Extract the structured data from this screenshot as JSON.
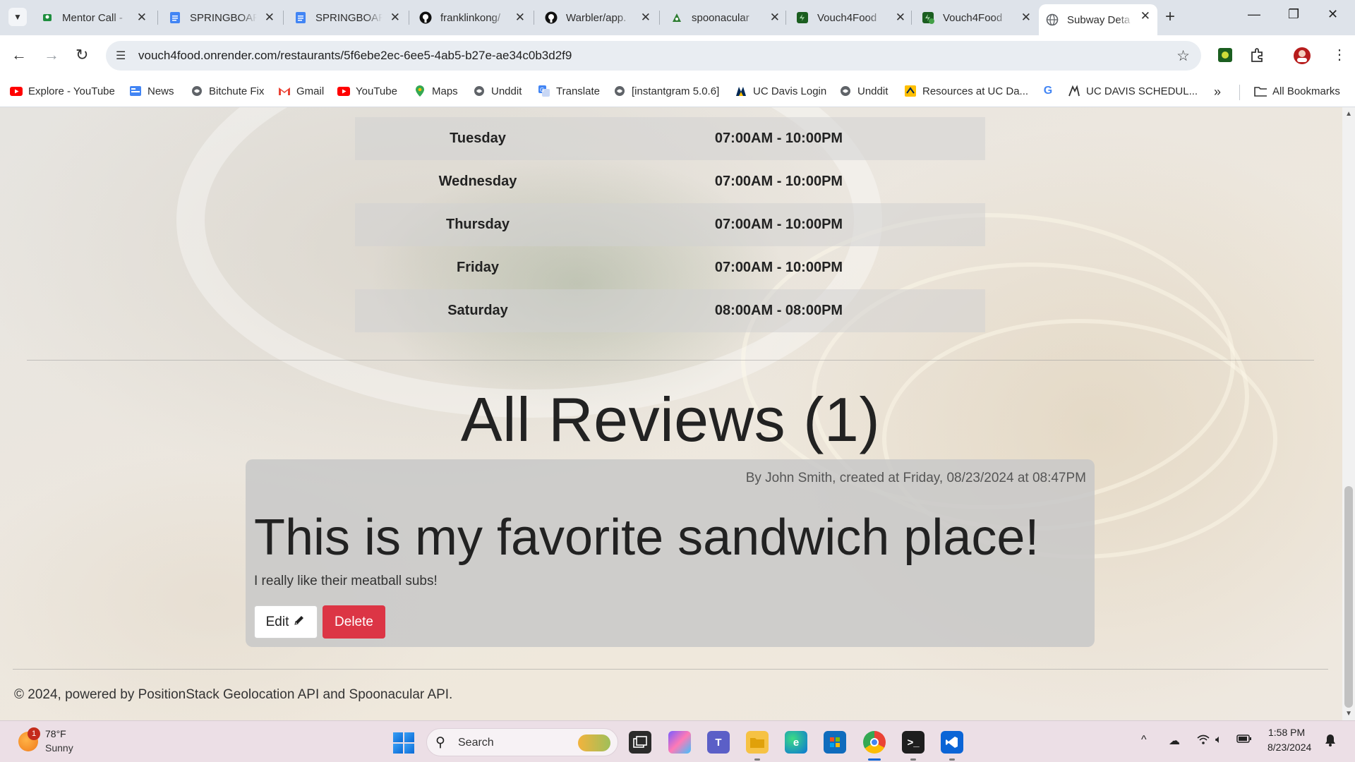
{
  "browser": {
    "tabs": [
      {
        "label": "Mentor Call - ",
        "icon": "meet-icon",
        "color": "#1e8e3e"
      },
      {
        "label": "SPRINGBOARD",
        "icon": "docs-icon",
        "color": "#4285f4"
      },
      {
        "label": "SPRINGBOARD",
        "icon": "docs-icon",
        "color": "#4285f4"
      },
      {
        "label": "franklinkong/",
        "icon": "github-icon",
        "color": "#111111"
      },
      {
        "label": "Warbler/app.",
        "icon": "github-icon",
        "color": "#111111"
      },
      {
        "label": "spoonacular",
        "icon": "spoonacular-icon",
        "color": "#2e7d32"
      },
      {
        "label": "Vouch4Food",
        "icon": "vouch4food-icon",
        "color": "#1b5e20"
      },
      {
        "label": "Vouch4Food",
        "icon": "vouch4food-icon",
        "color": "#1b5e20"
      },
      {
        "label": "Subway Deta",
        "icon": "globe-icon",
        "color": "#5f6368",
        "active": true
      }
    ],
    "url": "vouch4food.onrender.com/restaurants/5f6ebe2ec-6ee5-4ab5-b27e-ae34c0b3d2f9",
    "bookmarks": [
      {
        "label": "Explore - YouTube",
        "icon": "youtube-icon"
      },
      {
        "label": "News",
        "icon": "news-icon"
      },
      {
        "label": "Bitchute Fix",
        "icon": "globe-icon"
      },
      {
        "label": "Gmail",
        "icon": "gmail-icon"
      },
      {
        "label": "YouTube",
        "icon": "youtube-icon"
      },
      {
        "label": "Maps",
        "icon": "maps-icon"
      },
      {
        "label": "Unddit",
        "icon": "globe-icon"
      },
      {
        "label": "Translate",
        "icon": "translate-icon"
      },
      {
        "label": "[instantgram 5.0.6]",
        "icon": "globe-icon"
      },
      {
        "label": "UC Davis Login",
        "icon": "ucdavis-icon"
      },
      {
        "label": "Unddit",
        "icon": "globe-icon"
      },
      {
        "label": "Resources at UC Da...",
        "icon": "resources-icon"
      },
      {
        "label": "",
        "icon": "google-icon"
      },
      {
        "label": "UC DAVIS SCHEDUL...",
        "icon": "ucdavis-schedule-icon"
      }
    ],
    "all_bookmarks_label": "All Bookmarks"
  },
  "page": {
    "hours": [
      {
        "day": "Tuesday",
        "time": "07:00AM - 10:00PM"
      },
      {
        "day": "Wednesday",
        "time": "07:00AM - 10:00PM"
      },
      {
        "day": "Thursday",
        "time": "07:00AM - 10:00PM"
      },
      {
        "day": "Friday",
        "time": "07:00AM - 10:00PM"
      },
      {
        "day": "Saturday",
        "time": "08:00AM - 08:00PM"
      }
    ],
    "reviews_title": "All Reviews (1)",
    "review": {
      "meta": "By John Smith, created at Friday, 08/23/2024 at 08:47PM",
      "title": "This is my favorite sandwich place!",
      "body": "I really like their meatball subs!",
      "edit_label": "Edit",
      "delete_label": "Delete"
    },
    "footer": "© 2024, powered by PositionStack Geolocation API and Spoonacular API."
  },
  "taskbar": {
    "weather_temp": "78°F",
    "weather_cond": "Sunny",
    "weather_badge": "1",
    "search_label": "Search",
    "time": "1:58 PM",
    "date": "8/23/2024"
  },
  "colors": {
    "delete": "#dc3545",
    "accent": "#0a64d6"
  }
}
